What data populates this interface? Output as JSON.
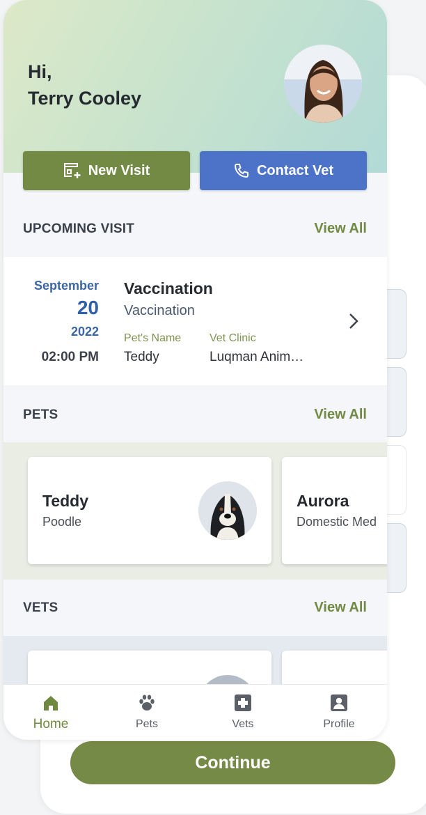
{
  "header": {
    "greeting": "Hi,",
    "user_name": "Terry Cooley",
    "new_visit_label": "New Visit",
    "contact_vet_label": "Contact Vet"
  },
  "upcoming": {
    "title": "UPCOMING VISIT",
    "view_all": "View All",
    "visit": {
      "month": "September",
      "day": "20",
      "year": "2022",
      "time": "02:00 PM",
      "title": "Vaccination",
      "subtitle": "Vaccination",
      "pet_label": "Pet's Name",
      "pet_value": "Teddy",
      "clinic_label": "Vet Clinic",
      "clinic_value": "Luqman Anim…"
    }
  },
  "pets": {
    "title": "PETS",
    "view_all": "View All",
    "items": [
      {
        "name": "Teddy",
        "breed": "Poodle"
      },
      {
        "name": "Aurora",
        "breed": "Domestic Med"
      }
    ]
  },
  "vets": {
    "title": "VETS",
    "view_all": "View All"
  },
  "tabbar": {
    "items": [
      {
        "label": "Home",
        "icon": "home-icon",
        "active": true
      },
      {
        "label": "Pets",
        "icon": "paw-icon",
        "active": false
      },
      {
        "label": "Vets",
        "icon": "medical-cross-icon",
        "active": false
      },
      {
        "label": "Profile",
        "icon": "profile-icon",
        "active": false
      }
    ]
  },
  "footer": {
    "continue_label": "Continue"
  },
  "colors": {
    "accent_green": "#738a44",
    "accent_blue": "#4d73c8",
    "date_blue": "#2f5fa8"
  }
}
